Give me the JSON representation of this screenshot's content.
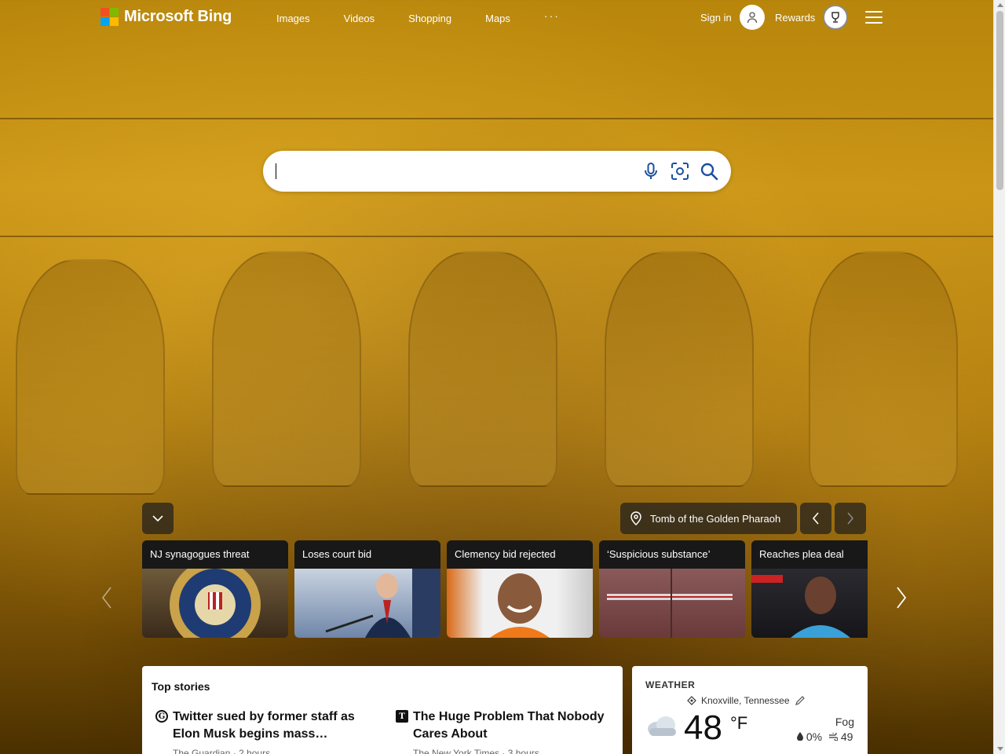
{
  "brand": {
    "name": "Microsoft Bing",
    "logo_colors": [
      "#f25022",
      "#7fba00",
      "#00a4ef",
      "#ffb900"
    ]
  },
  "nav": {
    "items": [
      "Images",
      "Videos",
      "Shopping",
      "Maps"
    ],
    "more": "···"
  },
  "account": {
    "signin_label": "Sign in",
    "rewards_label": "Rewards"
  },
  "search": {
    "value": "",
    "placeholder": ""
  },
  "background": {
    "location_label": "Tomb of the Golden Pharaoh"
  },
  "news_cards": [
    {
      "title": "NJ synagogues threat"
    },
    {
      "title": "Loses court bid"
    },
    {
      "title": "Clemency bid rejected"
    },
    {
      "title": "‘Suspicious substance’"
    },
    {
      "title": "Reaches plea deal"
    }
  ],
  "top_stories": {
    "heading": "Top stories",
    "items": [
      {
        "headline": "Twitter sued by former staff as Elon Musk begins mass…",
        "source": "The Guardian",
        "time": "2 hours",
        "source_icon": "G"
      },
      {
        "headline": "The Huge Problem That Nobody Cares About",
        "source": "The New York Times",
        "time": "3 hours",
        "source_icon": "T"
      }
    ]
  },
  "weather": {
    "title": "WEATHER",
    "location": "Knoxville, Tennessee",
    "temperature": "48",
    "unit": "°F",
    "condition": "Fog",
    "precipitation": "0%",
    "aqi": "49"
  }
}
